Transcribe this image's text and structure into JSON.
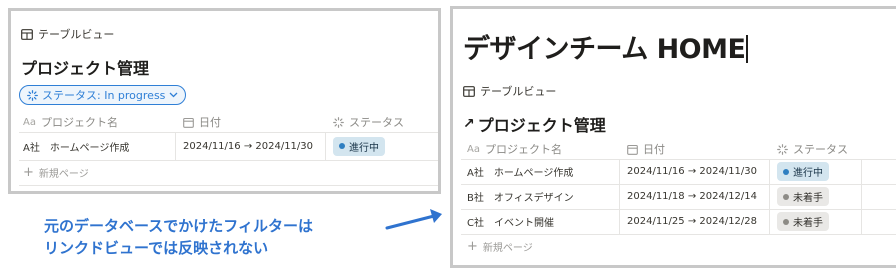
{
  "left": {
    "view_tab": "テーブルビュー",
    "db_title": "プロジェクト管理",
    "filter_label": "ステータス: In progress",
    "columns": [
      "プロジェクト名",
      "日付",
      "ステータス"
    ],
    "rows": [
      {
        "name": "A社　ホームページ作成",
        "date": "2024/11/16 → 2024/11/30",
        "status": "進行中",
        "status_kind": "progress"
      }
    ],
    "new_page": "新規ページ"
  },
  "right": {
    "page_title": "デザインチーム HOME",
    "view_tab": "テーブルビュー",
    "db_title": "プロジェクト管理",
    "columns": [
      "プロジェクト名",
      "日付",
      "ステータス"
    ],
    "rows": [
      {
        "name": "A社　ホームページ作成",
        "date": "2024/11/16 → 2024/11/30",
        "status": "進行中",
        "status_kind": "progress"
      },
      {
        "name": "B社　オフィスデザイン",
        "date": "2024/11/18 → 2024/12/14",
        "status": "未着手",
        "status_kind": "todo"
      },
      {
        "name": "C社　イベント開催",
        "date": "2024/11/25 → 2024/12/28",
        "status": "未着手",
        "status_kind": "todo"
      }
    ],
    "new_page": "新規ページ"
  },
  "annotation": {
    "line1": "元のデータベースでかけたフィルターは",
    "line2": "リンクドビューでは反映されない"
  },
  "colors": {
    "accent_blue": "#2f7fd6",
    "callout_blue": "#2f73cf",
    "progress_badge_bg": "#d3e5ef",
    "todo_badge_bg": "#e9e8e6",
    "panel_border": "#c8c8c8"
  },
  "icons": {
    "table": "table-icon",
    "filter_status": "status-spinner-icon",
    "text_prop": "text-property-icon",
    "calendar": "calendar-icon",
    "link_arrow": "link-arrow-icon",
    "plus": "plus-icon",
    "arrow": "callout-arrow"
  }
}
